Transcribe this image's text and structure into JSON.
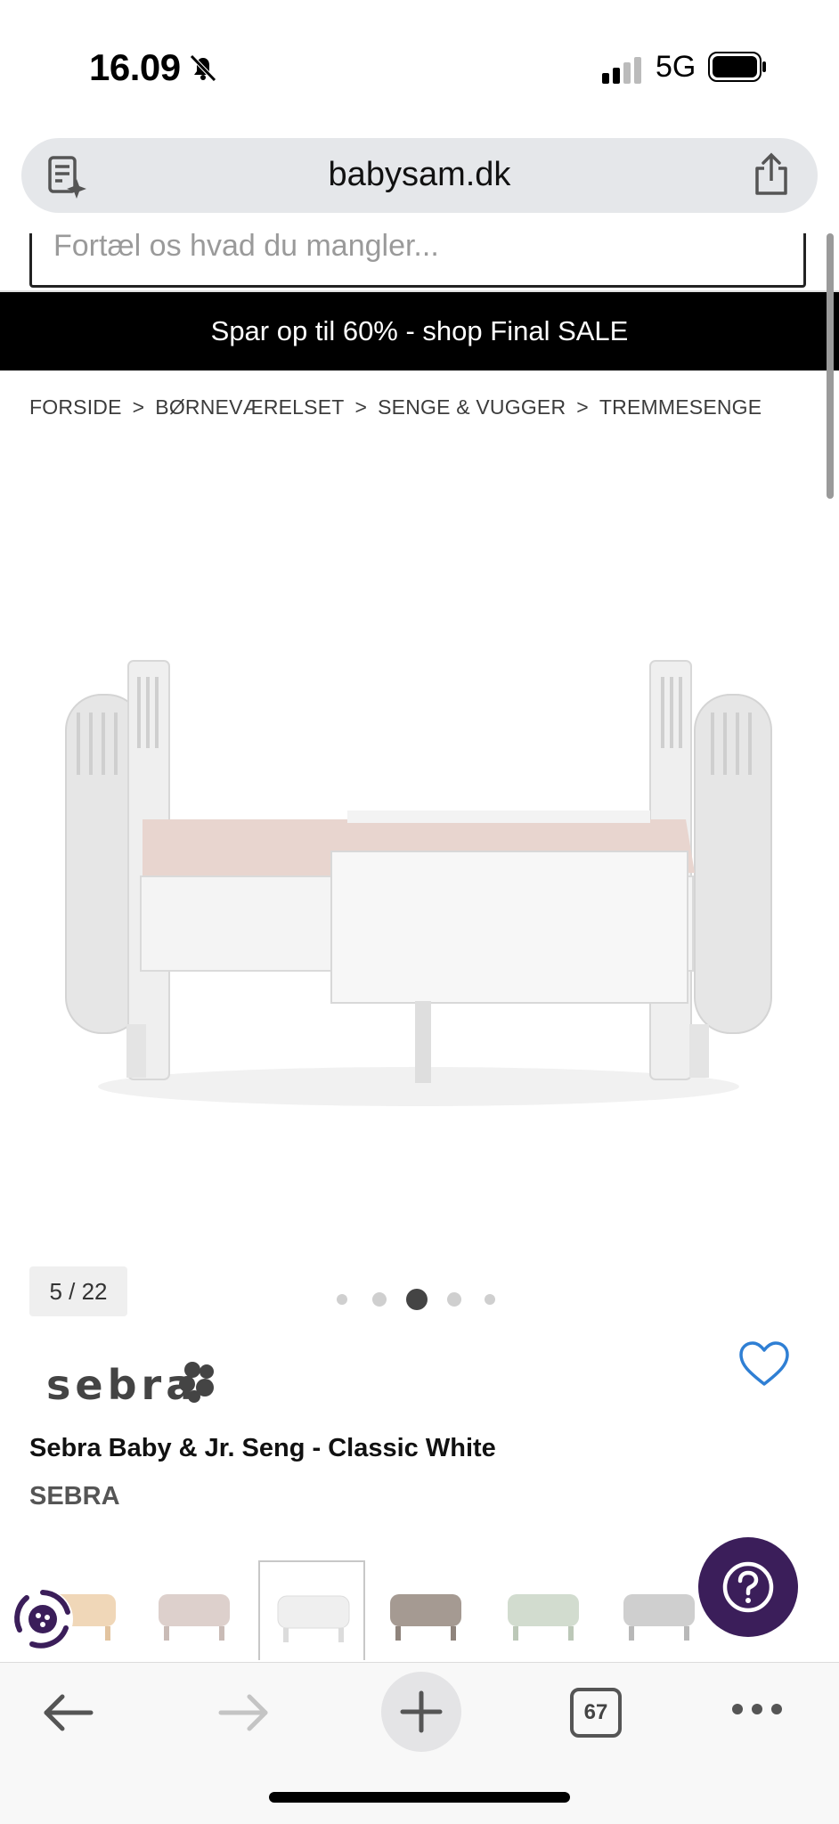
{
  "status_bar": {
    "time": "16.09",
    "network": "5G"
  },
  "browser": {
    "url": "babysam.dk"
  },
  "search": {
    "placeholder": "Fortæl os hvad du mangler..."
  },
  "promo": {
    "text": "Spar op til 60% - shop Final SALE"
  },
  "breadcrumb": {
    "items": [
      "FORSIDE",
      "BØRNEVÆRELSET",
      "SENGE & VUGGER",
      "TREMMESENGE"
    ],
    "separator": ">"
  },
  "gallery": {
    "counter": "5 / 22",
    "active_dot": 2,
    "dot_count": 5
  },
  "product": {
    "brand_logo": "sebra",
    "title": "Sebra Baby & Jr. Seng - Classic White",
    "brand": "SEBRA"
  },
  "variants": [
    {
      "name": "natural",
      "color": "#f0d7b8"
    },
    {
      "name": "pink",
      "color": "#ddd0cc"
    },
    {
      "name": "white",
      "color": "#efefef"
    },
    {
      "name": "taupe",
      "color": "#a59a92"
    },
    {
      "name": "green",
      "color": "#d2dccf"
    },
    {
      "name": "grey",
      "color": "#cfcfcf"
    }
  ],
  "toolbar": {
    "tab_count": "67"
  },
  "colors": {
    "promo_bg": "#000000",
    "help_button": "#3b1e5a",
    "wishlist": "#2f7fd4"
  }
}
